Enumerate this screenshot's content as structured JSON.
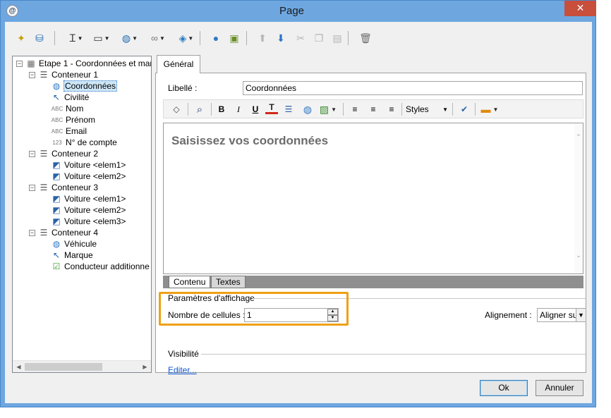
{
  "window": {
    "title": "Page",
    "app_icon": "@",
    "close_glyph": "✕"
  },
  "toolbar": {
    "icons": [
      {
        "name": "magic-wand-icon",
        "glyph": "✦",
        "color": "#c7a000",
        "dropdown": false
      },
      {
        "name": "database-refresh-icon",
        "glyph": "⛁",
        "color": "#1f6db3",
        "dropdown": false
      },
      {
        "name": "text-cursor-icon",
        "glyph": "Ꮖ",
        "color": "#333333",
        "dropdown": true
      },
      {
        "name": "select-action-icon",
        "glyph": "▭",
        "color": "#333333",
        "dropdown": true
      },
      {
        "name": "globe-icon",
        "glyph": "◍",
        "color": "#1f6db3",
        "dropdown": true
      },
      {
        "name": "link-icon",
        "glyph": "∞",
        "color": "#7a7a7a",
        "dropdown": true
      },
      {
        "name": "stack-icon",
        "glyph": "◈",
        "color": "#2b7cc2",
        "dropdown": true
      },
      {
        "name": "user-icon",
        "glyph": "●",
        "color": "#2f79c6",
        "dropdown": false
      },
      {
        "name": "add-component-icon",
        "glyph": "▣",
        "color": "#6a8f2a",
        "dropdown": false
      },
      {
        "name": "move-up-icon",
        "glyph": "⬆",
        "color": "#b5b5b5",
        "dropdown": false
      },
      {
        "name": "move-down-icon",
        "glyph": "⬇",
        "color": "#2b74c8",
        "dropdown": false
      },
      {
        "name": "cut-icon",
        "glyph": "✂",
        "color": "#b5b5b5",
        "dropdown": false
      },
      {
        "name": "copy-icon",
        "glyph": "❐",
        "color": "#b5b5b5",
        "dropdown": false
      },
      {
        "name": "paste-icon",
        "glyph": "▤",
        "color": "#b5b5b5",
        "dropdown": false
      },
      {
        "name": "delete-icon",
        "glyph": "🗑",
        "color": "#6d6d6d",
        "dropdown": false
      }
    ]
  },
  "tree": {
    "items": [
      {
        "level": 0,
        "expander": "−",
        "icon": "page-icon",
        "glyph": "▦",
        "icon_color": "#6d6d6d",
        "label": "Etape 1 - Coordonnées et mar",
        "selected": false
      },
      {
        "level": 1,
        "expander": "−",
        "icon": "container-icon",
        "glyph": "☰",
        "icon_color": "#555555",
        "label": "Conteneur 1",
        "selected": false
      },
      {
        "level": 2,
        "expander": "",
        "icon": "globe-icon",
        "glyph": "◍",
        "icon_color": "#2f79c6",
        "label": "Coordonnées",
        "selected": true
      },
      {
        "level": 2,
        "expander": "",
        "icon": "cursor-icon",
        "glyph": "↖",
        "icon_color": "#1f5fad",
        "label": "Civilité",
        "selected": false
      },
      {
        "level": 2,
        "expander": "",
        "icon": "text-field-icon",
        "glyph": "ABC",
        "icon_color": "#777777",
        "label": "Nom",
        "selected": false
      },
      {
        "level": 2,
        "expander": "",
        "icon": "text-field-icon",
        "glyph": "ABC",
        "icon_color": "#777777",
        "label": "Prénom",
        "selected": false
      },
      {
        "level": 2,
        "expander": "",
        "icon": "text-field-icon",
        "glyph": "ABC",
        "icon_color": "#777777",
        "label": "Email",
        "selected": false
      },
      {
        "level": 2,
        "expander": "",
        "icon": "number-field-icon",
        "glyph": "123",
        "icon_color": "#777777",
        "label": "N° de compte",
        "selected": false
      },
      {
        "level": 1,
        "expander": "−",
        "icon": "container-icon",
        "glyph": "☰",
        "icon_color": "#555555",
        "label": "Conteneur 2",
        "selected": false
      },
      {
        "level": 2,
        "expander": "",
        "icon": "image-icon",
        "glyph": "◩",
        "icon_color": "#2a62a8",
        "label": "Voiture <elem1>",
        "selected": false
      },
      {
        "level": 2,
        "expander": "",
        "icon": "image-icon",
        "glyph": "◩",
        "icon_color": "#2a62a8",
        "label": "Voiture <elem2>",
        "selected": false
      },
      {
        "level": 1,
        "expander": "−",
        "icon": "container-icon",
        "glyph": "☰",
        "icon_color": "#555555",
        "label": "Conteneur 3",
        "selected": false
      },
      {
        "level": 2,
        "expander": "",
        "icon": "image-icon",
        "glyph": "◩",
        "icon_color": "#2a62a8",
        "label": "Voiture <elem1>",
        "selected": false
      },
      {
        "level": 2,
        "expander": "",
        "icon": "image-icon",
        "glyph": "◩",
        "icon_color": "#2a62a8",
        "label": "Voiture <elem2>",
        "selected": false
      },
      {
        "level": 2,
        "expander": "",
        "icon": "image-icon",
        "glyph": "◩",
        "icon_color": "#2a62a8",
        "label": "Voiture <elem3>",
        "selected": false
      },
      {
        "level": 1,
        "expander": "−",
        "icon": "container-icon",
        "glyph": "☰",
        "icon_color": "#555555",
        "label": "Conteneur 4",
        "selected": false
      },
      {
        "level": 2,
        "expander": "",
        "icon": "globe-icon",
        "glyph": "◍",
        "icon_color": "#2f79c6",
        "label": "Véhicule",
        "selected": false
      },
      {
        "level": 2,
        "expander": "",
        "icon": "cursor-icon",
        "glyph": "↖",
        "icon_color": "#1f5fad",
        "label": "Marque",
        "selected": false
      },
      {
        "level": 2,
        "expander": "",
        "icon": "checkbox-icon",
        "glyph": "☑",
        "icon_color": "#3e9b2f",
        "label": "Conducteur additionne",
        "selected": false
      }
    ]
  },
  "properties": {
    "tab_label": "Général",
    "libelle_label": "Libellé :",
    "libelle_value": "Coordonnées",
    "editor_toolbar": {
      "source_glyph": "◇",
      "find_glyph": "⌕",
      "bold": "B",
      "italic": "I",
      "underline": "U",
      "text_color_glyph": "T",
      "list_glyph": "☰",
      "insert_link_glyph": "◍",
      "insert_image_glyph": "▨",
      "align_left": "≡",
      "align_center": "≡",
      "align_right": "≡",
      "styles_label": "Styles",
      "spellcheck_glyph": "✔",
      "insert_field_glyph": "▬"
    },
    "editor_content": "Saisissez vos coordonnées",
    "editor_tabs": [
      "Contenu",
      "Textes"
    ],
    "display_section": "Paramètres d'affichage",
    "cell_count_label": "Nombre de cellules :",
    "cell_count_value": "1",
    "alignment_label": "Alignement :",
    "alignment_value": "Aligner su",
    "visibility_section": "Visibilité",
    "edit_link": "Editer..."
  },
  "buttons": {
    "ok": "Ok",
    "cancel": "Annuler"
  },
  "colors": {
    "window_frame": "#6ea7e0",
    "close_button": "#c74f3c",
    "highlight": "#f0a015",
    "link": "#1155cc"
  }
}
